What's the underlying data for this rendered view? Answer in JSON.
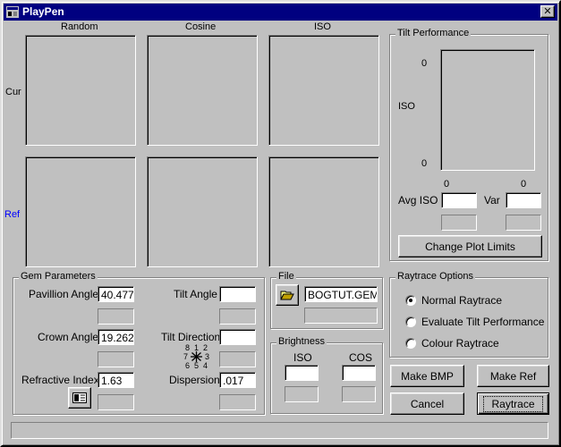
{
  "window": {
    "title": "PlayPen",
    "close_glyph": "✕"
  },
  "plots": {
    "column_headers": [
      "Random",
      "Cosine",
      "ISO"
    ],
    "row_labels": [
      "Cur",
      "Ref"
    ],
    "ref_label_color": "#0000ff"
  },
  "tilt_performance": {
    "group_title": "Tilt Performance",
    "y_top": "0",
    "y_axis_label": "ISO",
    "y_bottom": "0",
    "x_left": "0",
    "x_right": "0",
    "avg_iso_label": "Avg ISO",
    "avg_iso_value": "",
    "var_label": "Var",
    "var_value": "",
    "change_plot_limits_label": "Change Plot Limits"
  },
  "gem_parameters": {
    "group_title": "Gem Parameters",
    "pavilion_angle_label": "Pavillion Angle",
    "pavilion_angle_value": "40.477",
    "crown_angle_label": "Crown Angle",
    "crown_angle_value": "19.262",
    "refractive_index_label": "Refractive Index",
    "refractive_index_value": "1.63",
    "tilt_angle_label": "Tilt Angle",
    "tilt_angle_value": "",
    "tilt_direction_label": "Tilt Direction",
    "tilt_direction_value": "",
    "direction_digits": [
      "8",
      "1",
      "2",
      "7",
      "3",
      "6",
      "5",
      "4"
    ],
    "dispersion_label": "Dispersion",
    "dispersion_value": ".017"
  },
  "file": {
    "group_title": "File",
    "filename": "BOGTUT.GEM"
  },
  "brightness": {
    "group_title": "Brightness",
    "iso_label": "ISO",
    "iso_value": "",
    "cos_label": "COS",
    "cos_value": ""
  },
  "raytrace_options": {
    "group_title": "Raytrace Options",
    "options": [
      "Normal Raytrace",
      "Evaluate Tilt Performance",
      "Colour Raytrace"
    ],
    "selected": "Normal Raytrace"
  },
  "buttons": {
    "make_bmp": "Make BMP",
    "make_ref": "Make Ref",
    "cancel": "Cancel",
    "raytrace": "Raytrace"
  },
  "icons": {
    "app": "gem-app-icon",
    "open_file": "folder-open-icon",
    "refractive_table": "table-lookup-icon",
    "tilt_center": "asterisk-icon"
  }
}
